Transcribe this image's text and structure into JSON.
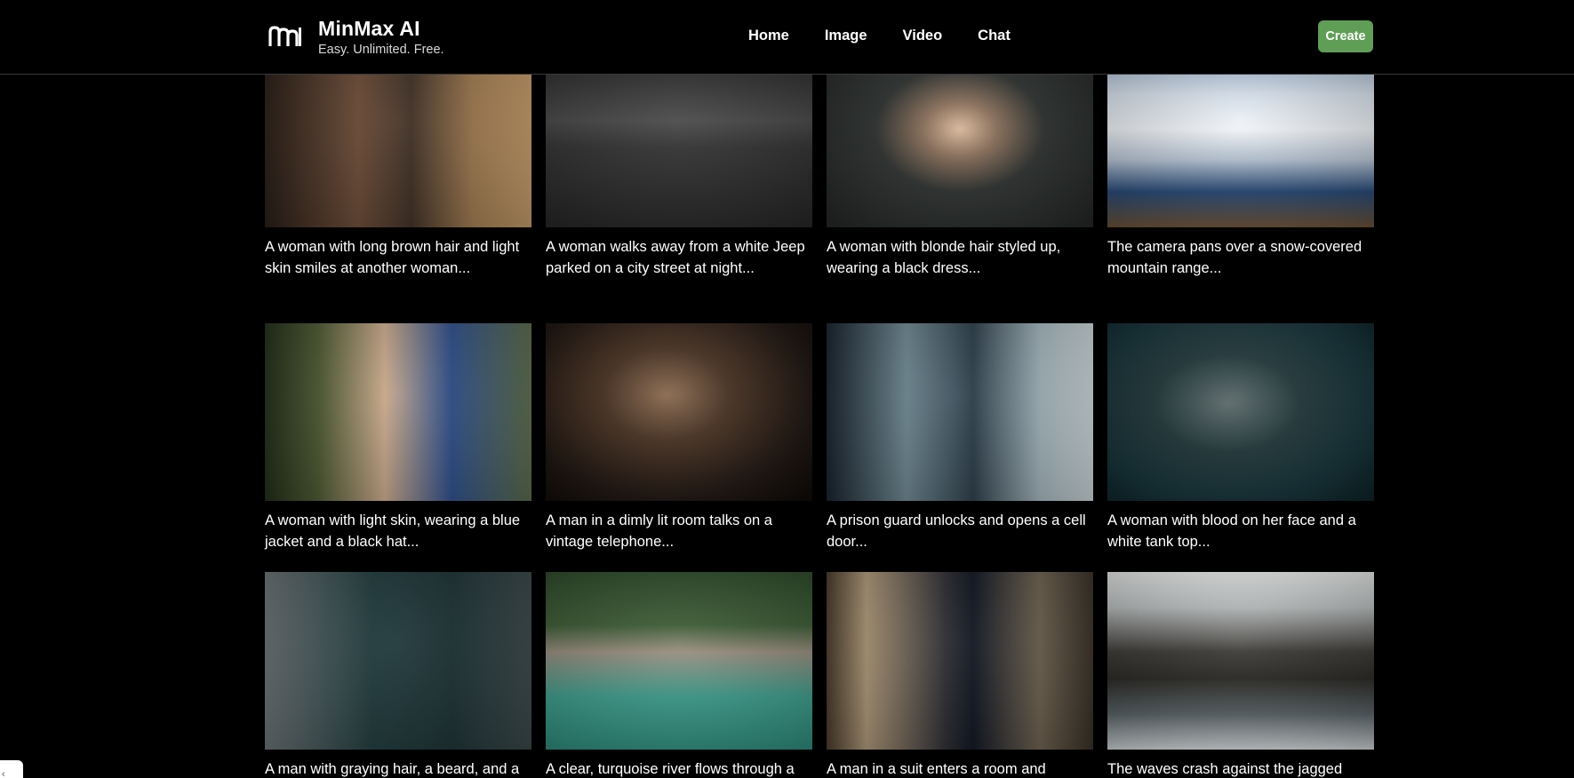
{
  "brand": {
    "title": "MinMax AI",
    "tagline": "Easy. Unlimited. Free."
  },
  "nav": [
    {
      "label": "Home"
    },
    {
      "label": "Image"
    },
    {
      "label": "Video"
    },
    {
      "label": "Chat"
    }
  ],
  "header": {
    "create_label": "Create"
  },
  "colors": {
    "background": "#000000",
    "accent": "#5f9e55",
    "text": "#ffffff"
  },
  "videos": [
    {
      "caption": "A woman with long brown hair and light skin smiles at another woman..."
    },
    {
      "caption": "A woman walks away from a white Jeep parked on a city street at night..."
    },
    {
      "caption": "A woman with blonde hair styled up, wearing a black dress..."
    },
    {
      "caption": "The camera pans over a snow-covered mountain range..."
    },
    {
      "caption": "A woman with light skin, wearing a blue jacket and a black hat..."
    },
    {
      "caption": "A man in a dimly lit room talks on a vintage telephone..."
    },
    {
      "caption": "A prison guard unlocks and opens a cell door..."
    },
    {
      "caption": "A woman with blood on her face and a white tank top..."
    },
    {
      "caption": "A man with graying hair, a beard, and a"
    },
    {
      "caption": "A clear, turquoise river flows through a"
    },
    {
      "caption": "A man in a suit enters a room and speaks"
    },
    {
      "caption": "The waves crash against the jagged"
    }
  ],
  "corner_widget": {
    "icon": "chevron-icon",
    "glyph": "‹"
  }
}
